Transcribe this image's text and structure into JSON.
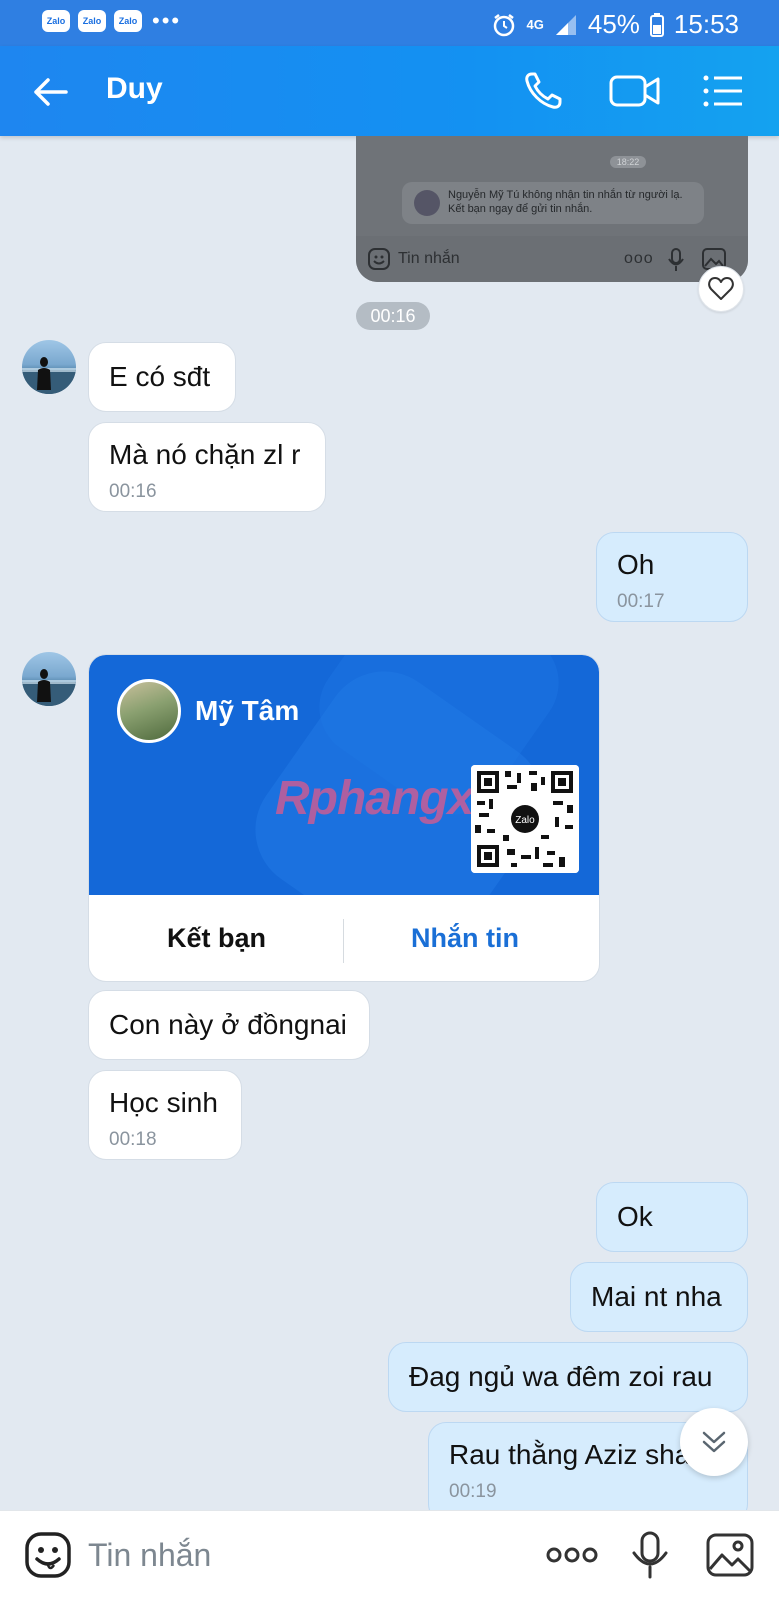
{
  "status_bar": {
    "app_icons": [
      "Zalo",
      "Zalo",
      "Zalo"
    ],
    "more_dots": "•••",
    "network": "4G",
    "battery": "45%",
    "time": "15:53"
  },
  "header": {
    "title": "Duy"
  },
  "forwarded_screenshot": {
    "time": "18:22",
    "notice_line1": "Nguyễn Mỹ Tú không nhận tin nhắn từ người lạ.",
    "notice_line2": "Kết bạn ngay để gửi tin nhắn.",
    "input_placeholder": "Tin nhắn",
    "more": "ooo"
  },
  "time_pill": "00:16",
  "messages": [
    {
      "text": "E có sđt",
      "time": ""
    },
    {
      "text": "Mà nó chặn zl r",
      "time": "00:16"
    },
    {
      "text": "Oh",
      "time": "00:17"
    },
    {
      "text": "Con này ở đồngnai",
      "time": ""
    },
    {
      "text": "Học sinh",
      "time": "00:18"
    },
    {
      "text": "Ok",
      "time": ""
    },
    {
      "text": "Mai nt nha",
      "time": ""
    },
    {
      "text": "Đag ngủ wa đêm zoi rau",
      "time": ""
    },
    {
      "text": "Rau thằng Aziz share",
      "time": "00:19"
    }
  ],
  "contact_card": {
    "name": "Mỹ Tâm",
    "watermark": "Rphangx",
    "qr_badge": "Zalo",
    "add_friend": "Kết bạn",
    "message": "Nhắn tin"
  },
  "input_bar": {
    "placeholder": "Tin nhắn",
    "more": "ooo"
  },
  "colors": {
    "header_blue": "#1e86f0",
    "outgoing_bubble": "#d6ecfd",
    "card_blue": "#1468d8",
    "link_blue": "#1a6fd6"
  }
}
